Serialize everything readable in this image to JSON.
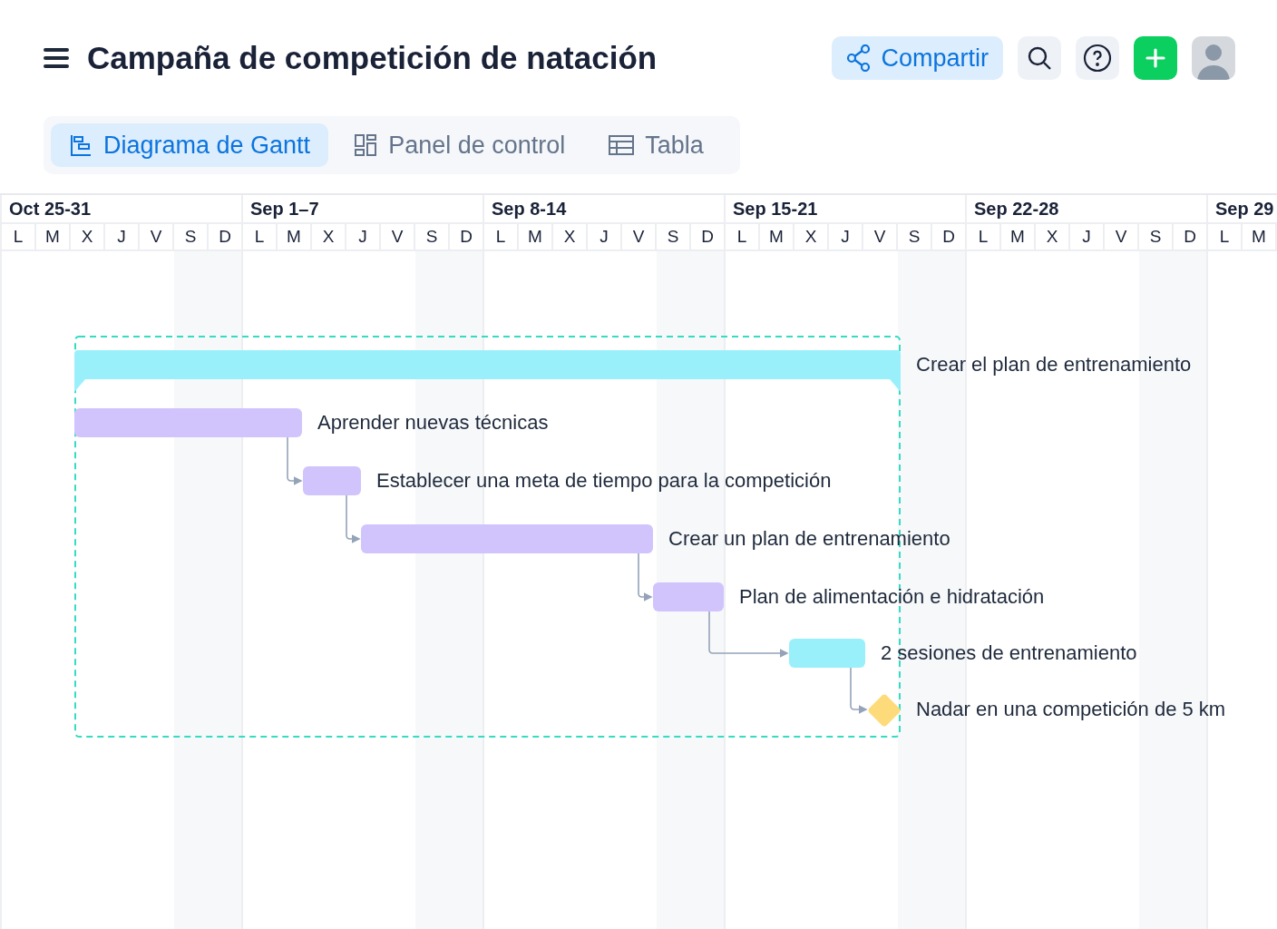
{
  "title": "Campaña de competición de natación",
  "share_button": "Compartir",
  "tabs": [
    {
      "label": "Diagrama de Gantt",
      "kind": "gantt",
      "selected": true
    },
    {
      "label": "Panel de control",
      "kind": "dashboard",
      "selected": false
    },
    {
      "label": "Tabla",
      "kind": "table",
      "selected": false
    }
  ],
  "weeks": [
    {
      "label": "Oct 25-31",
      "days": [
        "L",
        "M",
        "X",
        "J",
        "V",
        "S",
        "D"
      ]
    },
    {
      "label": "Sep 1–7",
      "days": [
        "L",
        "M",
        "X",
        "J",
        "V",
        "S",
        "D"
      ]
    },
    {
      "label": "Sep 8-14",
      "days": [
        "L",
        "M",
        "X",
        "J",
        "V",
        "S",
        "D"
      ]
    },
    {
      "label": "Sep 15-21",
      "days": [
        "L",
        "M",
        "X",
        "J",
        "V",
        "S",
        "D"
      ]
    },
    {
      "label": "Sep 22-28",
      "days": [
        "L",
        "M",
        "X",
        "J",
        "V",
        "S",
        "D"
      ]
    },
    {
      "label": "Sep 29",
      "days": [
        "L",
        "M"
      ]
    }
  ],
  "tasks": [
    {
      "name": "Crear el plan de entrenamiento",
      "kind": "summary",
      "color": "#99f0fa"
    },
    {
      "name": "Aprender nuevas técnicas",
      "kind": "task",
      "color": "#d1c4fd"
    },
    {
      "name": "Establecer una meta de tiempo para la competición",
      "kind": "task",
      "color": "#d1c4fd"
    },
    {
      "name": "Crear un plan de entrenamiento",
      "kind": "task",
      "color": "#d1c4fd"
    },
    {
      "name": "Plan de alimentación e hidratación",
      "kind": "task",
      "color": "#d1c4fd"
    },
    {
      "name": "2 sesiones de entrenamiento",
      "kind": "task",
      "color": "#99f0fa"
    },
    {
      "name": "Nadar en una competición de 5 km",
      "kind": "milestone",
      "color": "#fedb7a"
    }
  ]
}
